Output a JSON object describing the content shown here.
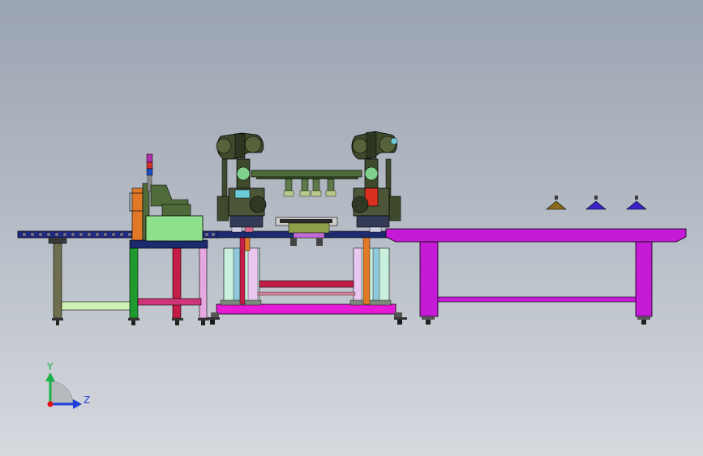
{
  "triad": {
    "y_label": "Y",
    "z_label": "Z"
  },
  "colors": {
    "background_top": "#9ba4b2",
    "background_bottom": "#d6d9de",
    "workbench": "#c51ad6",
    "robot_body": "#3f4a2c",
    "frame_red": "#c41e48",
    "frame_green": "#1f9a2f",
    "conveyor_belt": "#1e2a8a",
    "axis_y": "#19b24a",
    "axis_z": "#1f3fd8",
    "axis_origin": "#e01010"
  },
  "icons": [
    "coordinate-triad-icon"
  ]
}
